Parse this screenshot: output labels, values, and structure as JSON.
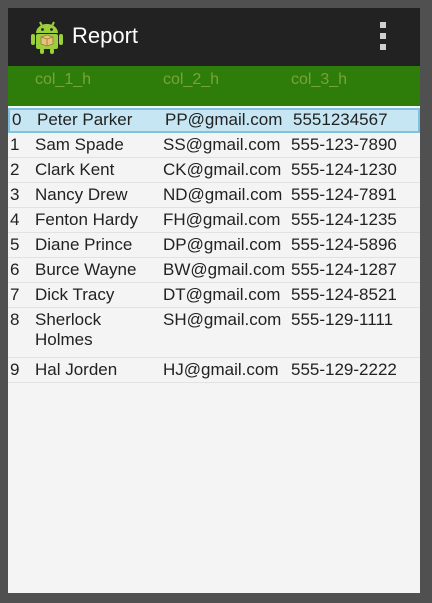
{
  "actionbar": {
    "title": "Report",
    "app_icon": "android-icon",
    "overflow_icon": "overflow-menu-icon"
  },
  "table": {
    "headers": [
      "col_1_h",
      "col_2_h",
      "col_3_h"
    ],
    "rows": [
      {
        "index": "0",
        "name": "Peter Parker",
        "email": "PP@gmail.com",
        "phone": "5551234567"
      },
      {
        "index": "1",
        "name": "Sam Spade",
        "email": "SS@gmail.com",
        "phone": "555-123-7890"
      },
      {
        "index": "2",
        "name": "Clark Kent",
        "email": "CK@gmail.com",
        "phone": "555-124-1230"
      },
      {
        "index": "3",
        "name": "Nancy Drew",
        "email": "ND@gmail.com",
        "phone": "555-124-7891"
      },
      {
        "index": "4",
        "name": "Fenton Hardy",
        "email": "FH@gmail.com",
        "phone": "555-124-1235"
      },
      {
        "index": "5",
        "name": "Diane Prince",
        "email": "DP@gmail.com",
        "phone": "555-124-5896"
      },
      {
        "index": "6",
        "name": "Burce Wayne",
        "email": "BW@gmail.com",
        "phone": "555-124-1287"
      },
      {
        "index": "7",
        "name": "Dick Tracy",
        "email": "DT@gmail.com",
        "phone": "555-124-8521"
      },
      {
        "index": "8",
        "name": "Sherlock Holmes",
        "email": "SH@gmail.com",
        "phone": "555-129-1111"
      },
      {
        "index": "9",
        "name": "Hal Jorden",
        "email": "HJ@gmail.com",
        "phone": "555-129-2222"
      }
    ]
  },
  "colors": {
    "actionbar_bg": "#222222",
    "header_bg": "#2e7d0a",
    "header_text": "#7aa23a",
    "selected_row_bg": "#c6e6f3"
  }
}
